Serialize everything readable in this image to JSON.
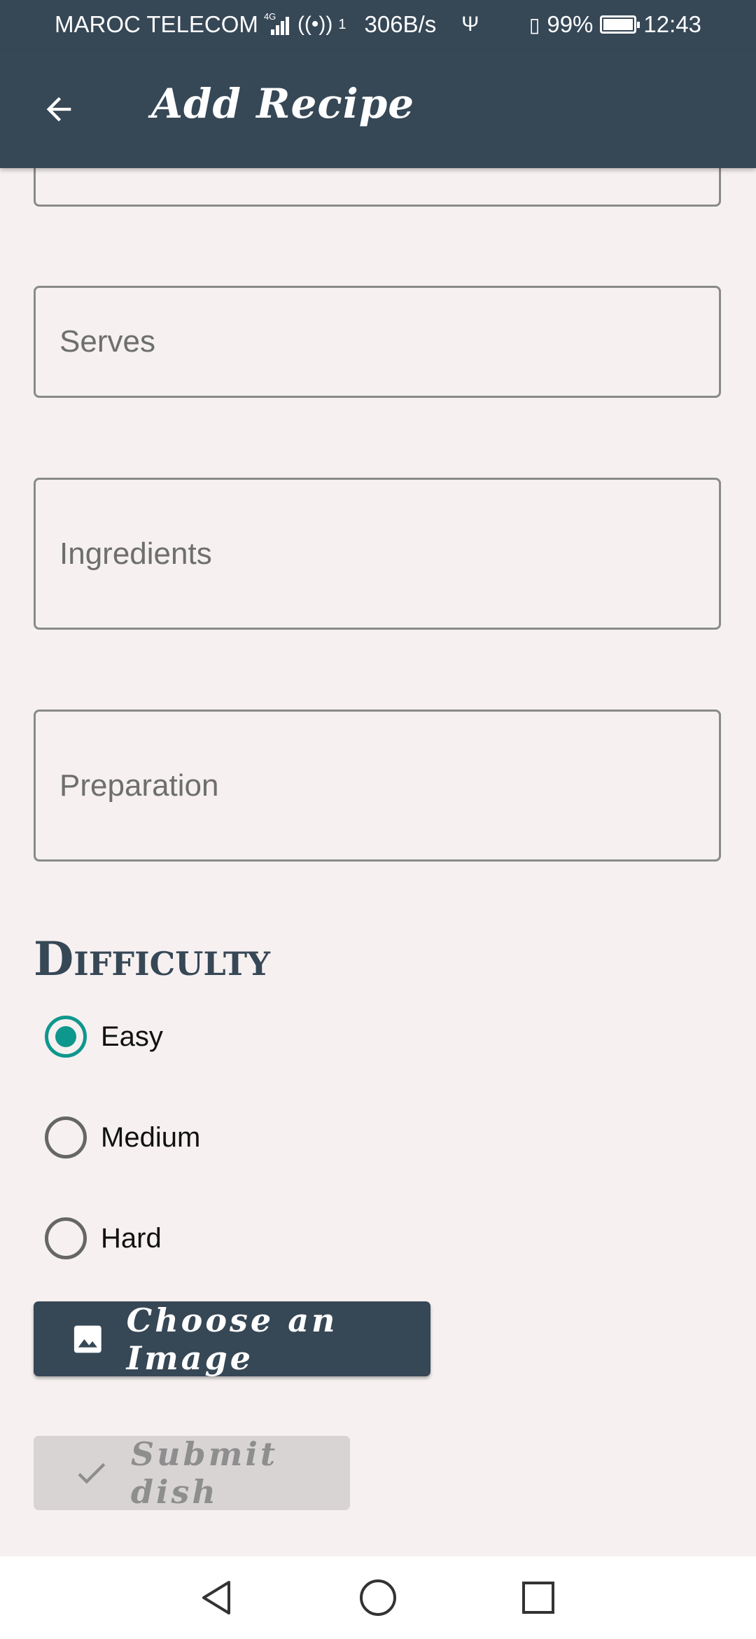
{
  "status_bar": {
    "carrier": "MAROC TELECOM",
    "network_type": "4G",
    "hotspot_count": "1",
    "net_speed": "306B/s",
    "battery_level": "99%",
    "battery_fraction": 0.99,
    "time": "12:43"
  },
  "app_bar": {
    "title": "Add Recipe",
    "back_icon": "arrow-left-icon"
  },
  "form": {
    "serves_placeholder": "Serves",
    "ingredients_placeholder": "Ingredients",
    "preparation_placeholder": "Preparation"
  },
  "difficulty": {
    "title": "Difficulty",
    "options": [
      {
        "label": "Easy",
        "checked": true
      },
      {
        "label": "Medium",
        "checked": false
      },
      {
        "label": "Hard",
        "checked": false
      }
    ]
  },
  "buttons": {
    "choose_image_label": "Choose an Image",
    "choose_image_icon": "image-icon",
    "submit_label": "Submit dish",
    "submit_icon": "check-icon",
    "submit_enabled": false
  },
  "nav": {
    "back": "triangle-back-icon",
    "home": "circle-home-icon",
    "recents": "square-recents-icon"
  },
  "colors": {
    "primary": "#364756",
    "accent": "#0E978D",
    "background": "#F6F0F0",
    "disabled_bg": "#D8D4D4"
  }
}
